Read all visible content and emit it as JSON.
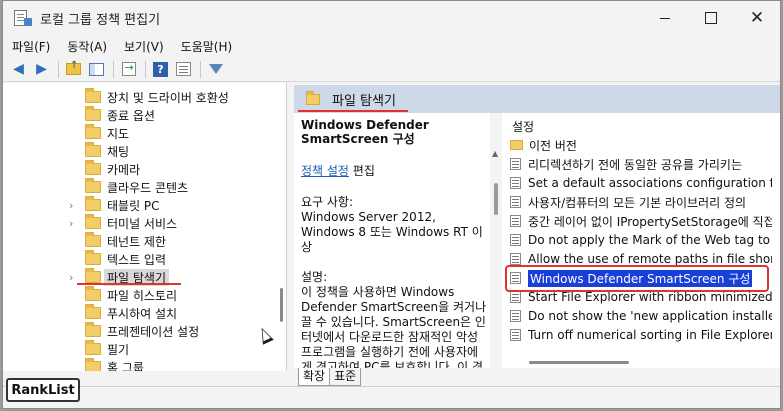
{
  "window": {
    "title": "로컬 그룹 정책 편집기",
    "controls": {
      "minimize": "",
      "maximize": "",
      "close": "✕"
    }
  },
  "menu": [
    "파일(F)",
    "동작(A)",
    "보기(V)",
    "도움말(H)"
  ],
  "toolbar": {
    "icons": [
      "back-arrow-icon",
      "forward-arrow-icon",
      "up-folder-icon",
      "show-hide-tree-icon",
      "export-list-icon",
      "help-icon",
      "properties-icon",
      "filter-icon"
    ],
    "help_glyph": "?"
  },
  "tree": {
    "items": [
      {
        "label": "장치 및 드라이버 호환성",
        "expandable": false,
        "selected": false
      },
      {
        "label": "종료 옵션",
        "expandable": false,
        "selected": false
      },
      {
        "label": "지도",
        "expandable": false,
        "selected": false
      },
      {
        "label": "채팅",
        "expandable": false,
        "selected": false
      },
      {
        "label": "카메라",
        "expandable": false,
        "selected": false
      },
      {
        "label": "클라우드 콘텐츠",
        "expandable": false,
        "selected": false
      },
      {
        "label": "태블릿 PC",
        "expandable": true,
        "selected": false
      },
      {
        "label": "터미널 서비스",
        "expandable": true,
        "selected": false
      },
      {
        "label": "테넌트 제한",
        "expandable": false,
        "selected": false
      },
      {
        "label": "텍스트 입력",
        "expandable": false,
        "selected": false
      },
      {
        "label": "파일 탐색기",
        "expandable": true,
        "selected": true
      },
      {
        "label": "파일 히스토리",
        "expandable": false,
        "selected": false
      },
      {
        "label": "푸시하여 설치",
        "expandable": false,
        "selected": false
      },
      {
        "label": "프레젠테이션 설정",
        "expandable": false,
        "selected": false
      },
      {
        "label": "필기",
        "expandable": false,
        "selected": false
      },
      {
        "label": "홈 그룹",
        "expandable": false,
        "selected": false
      }
    ],
    "chevron": "›"
  },
  "right_header": {
    "title": "파일 탐색기"
  },
  "description": {
    "title": "Windows Defender SmartScreen 구성",
    "edit_link": "정책 설정",
    "edit_suffix": " 편집",
    "requirements_label": "요구 사항:",
    "requirements_text": "Windows Server 2012, Windows 8 또는 Windows RT 이상",
    "desc_label": "설명:",
    "desc_text": "이 정책을 사용하면 Windows Defender SmartScreen을 켜거나 끌 수 있습니다. SmartScreen은 인터넷에서 다운로드한 잠재적인 악성 프로그램을 실행하기 전에 사용자에게 경고하여 PC를 보호합니다. 이 경고는 인터넷에서 다운로"
  },
  "settings": {
    "header": "설정",
    "rows": [
      {
        "type": "folder",
        "text": "이전 버전",
        "highlight": false
      },
      {
        "type": "setting",
        "text": "리디렉션하기 전에 동일한 공유를 가리키는",
        "highlight": false
      },
      {
        "type": "setting",
        "text": "Set a default associations configuration file",
        "highlight": false
      },
      {
        "type": "setting",
        "text": "사용자/컴퓨터의 모든 기본 라이브러리 정의",
        "highlight": false
      },
      {
        "type": "setting",
        "text": "중간 레이어 없이 IPropertySetStorage에 직접",
        "highlight": false
      },
      {
        "type": "setting",
        "text": "Do not apply the Mark of the Web tag to fi",
        "highlight": false
      },
      {
        "type": "setting",
        "text": "Allow the use of remote paths in file shortc",
        "highlight": false
      },
      {
        "type": "setting",
        "text": "Windows Defender SmartScreen 구성",
        "highlight": true
      },
      {
        "type": "setting",
        "text": "Start File Explorer with ribbon minimized(E",
        "highlight": false
      },
      {
        "type": "setting",
        "text": "Do not show the 'new application installed'",
        "highlight": false
      },
      {
        "type": "setting",
        "text": "Turn off numerical sorting in File Explorer(E",
        "highlight": false
      }
    ]
  },
  "tabs": [
    "확장",
    "표준"
  ],
  "overlay_label": "RankList",
  "colors": {
    "highlight": "#1a3fd8",
    "annotation_red": "#dd3333",
    "header_bg": "#cdd9e8"
  }
}
